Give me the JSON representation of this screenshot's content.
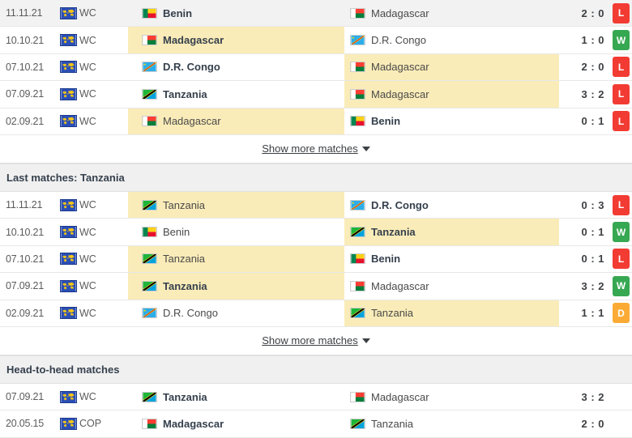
{
  "colors": {
    "win": "#36a852",
    "loss": "#f23c33",
    "draw": "#fbab35",
    "highlight": "#faecb8",
    "section_bg": "#f0f0f0"
  },
  "sections": [
    {
      "id": "last-matches-madagascar",
      "header": null,
      "rows": [
        {
          "date": "11.11.21",
          "comp": "WC",
          "comp_icon": "world-map-icon",
          "home": "Benin",
          "home_flag": "benin",
          "home_bold": true,
          "home_hl": false,
          "away": "Madagascar",
          "away_flag": "madagascar",
          "away_bold": false,
          "away_hl": false,
          "score": "2 : 0",
          "result": "L",
          "row_hover": true
        },
        {
          "date": "10.10.21",
          "comp": "WC",
          "comp_icon": "world-map-icon",
          "home": "Madagascar",
          "home_flag": "madagascar",
          "home_bold": true,
          "home_hl": true,
          "away": "D.R. Congo",
          "away_flag": "drcongo",
          "away_bold": false,
          "away_hl": false,
          "score": "1 : 0",
          "result": "W",
          "row_hover": false
        },
        {
          "date": "07.10.21",
          "comp": "WC",
          "comp_icon": "world-map-icon",
          "home": "D.R. Congo",
          "home_flag": "drcongo",
          "home_bold": true,
          "home_hl": false,
          "away": "Madagascar",
          "away_flag": "madagascar",
          "away_bold": false,
          "away_hl": true,
          "score": "2 : 0",
          "result": "L",
          "row_hover": false
        },
        {
          "date": "07.09.21",
          "comp": "WC",
          "comp_icon": "world-map-icon",
          "home": "Tanzania",
          "home_flag": "tanzania",
          "home_bold": true,
          "home_hl": false,
          "away": "Madagascar",
          "away_flag": "madagascar",
          "away_bold": false,
          "away_hl": true,
          "score": "3 : 2",
          "result": "L",
          "row_hover": false
        },
        {
          "date": "02.09.21",
          "comp": "WC",
          "comp_icon": "world-map-icon",
          "home": "Madagascar",
          "home_flag": "madagascar",
          "home_bold": false,
          "home_hl": true,
          "away": "Benin",
          "away_flag": "benin",
          "away_bold": true,
          "away_hl": false,
          "score": "0 : 1",
          "result": "L",
          "row_hover": false
        }
      ],
      "show_more": "Show more matches"
    },
    {
      "id": "last-matches-tanzania",
      "header": "Last matches: Tanzania",
      "rows": [
        {
          "date": "11.11.21",
          "comp": "WC",
          "comp_icon": "world-map-icon",
          "home": "Tanzania",
          "home_flag": "tanzania",
          "home_bold": false,
          "home_hl": true,
          "away": "D.R. Congo",
          "away_flag": "drcongo",
          "away_bold": true,
          "away_hl": false,
          "score": "0 : 3",
          "result": "L",
          "row_hover": false
        },
        {
          "date": "10.10.21",
          "comp": "WC",
          "comp_icon": "world-map-icon",
          "home": "Benin",
          "home_flag": "benin",
          "home_bold": false,
          "home_hl": false,
          "away": "Tanzania",
          "away_flag": "tanzania",
          "away_bold": true,
          "away_hl": true,
          "score": "0 : 1",
          "result": "W",
          "row_hover": false
        },
        {
          "date": "07.10.21",
          "comp": "WC",
          "comp_icon": "world-map-icon",
          "home": "Tanzania",
          "home_flag": "tanzania",
          "home_bold": false,
          "home_hl": true,
          "away": "Benin",
          "away_flag": "benin",
          "away_bold": true,
          "away_hl": false,
          "score": "0 : 1",
          "result": "L",
          "row_hover": false
        },
        {
          "date": "07.09.21",
          "comp": "WC",
          "comp_icon": "world-map-icon",
          "home": "Tanzania",
          "home_flag": "tanzania",
          "home_bold": true,
          "home_hl": true,
          "away": "Madagascar",
          "away_flag": "madagascar",
          "away_bold": false,
          "away_hl": false,
          "score": "3 : 2",
          "result": "W",
          "row_hover": false
        },
        {
          "date": "02.09.21",
          "comp": "WC",
          "comp_icon": "world-map-icon",
          "home": "D.R. Congo",
          "home_flag": "drcongo",
          "home_bold": false,
          "home_hl": false,
          "away": "Tanzania",
          "away_flag": "tanzania",
          "away_bold": false,
          "away_hl": true,
          "score": "1 : 1",
          "result": "D",
          "row_hover": false
        }
      ],
      "show_more": "Show more matches"
    },
    {
      "id": "head-to-head",
      "header": "Head-to-head matches",
      "rows": [
        {
          "date": "07.09.21",
          "comp": "WC",
          "comp_icon": "world-map-icon",
          "home": "Tanzania",
          "home_flag": "tanzania",
          "home_bold": true,
          "home_hl": false,
          "away": "Madagascar",
          "away_flag": "madagascar",
          "away_bold": false,
          "away_hl": false,
          "score": "3 : 2",
          "result": null,
          "row_hover": false
        },
        {
          "date": "20.05.15",
          "comp": "COP",
          "comp_icon": "world-map-icon",
          "home": "Madagascar",
          "home_flag": "madagascar",
          "home_bold": true,
          "home_hl": false,
          "away": "Tanzania",
          "away_flag": "tanzania",
          "away_bold": false,
          "away_hl": false,
          "score": "2 : 0",
          "result": null,
          "row_hover": false
        }
      ],
      "show_more": null
    }
  ]
}
